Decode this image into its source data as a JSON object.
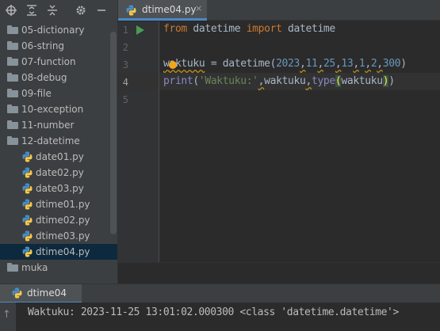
{
  "project": {
    "tree": [
      {
        "label": "05-dictionary",
        "kind": "folder"
      },
      {
        "label": "06-string",
        "kind": "folder"
      },
      {
        "label": "07-function",
        "kind": "folder"
      },
      {
        "label": "08-debug",
        "kind": "folder"
      },
      {
        "label": "09-file",
        "kind": "folder"
      },
      {
        "label": "10-exception",
        "kind": "folder"
      },
      {
        "label": "11-number",
        "kind": "folder"
      },
      {
        "label": "12-datetime",
        "kind": "folder"
      },
      {
        "label": "date01.py",
        "kind": "python-file"
      },
      {
        "label": "date02.py",
        "kind": "python-file"
      },
      {
        "label": "date03.py",
        "kind": "python-file"
      },
      {
        "label": "dtime01.py",
        "kind": "python-file"
      },
      {
        "label": "dtime02.py",
        "kind": "python-file"
      },
      {
        "label": "dtime03.py",
        "kind": "python-file"
      },
      {
        "label": "dtime04.py",
        "kind": "python-file",
        "selected": true
      },
      {
        "label": "muka",
        "kind": "folder"
      }
    ]
  },
  "editor": {
    "tab_label": "dtime04.py",
    "tab_close": "×",
    "line_numbers": [
      "1",
      "2",
      "3",
      "4",
      "5"
    ],
    "current_line": "4",
    "line1": {
      "kw1": "from",
      "mod": " datetime ",
      "kw2": "import",
      "name": " datetime"
    },
    "line3": {
      "var": "waktuku",
      "assign": " = datetime(",
      "n1": "2023",
      "c1": ",",
      "n2": "11",
      "c2": ",",
      "n3": "25",
      "c3": ",",
      "n4": "13",
      "c4": ",",
      "n5": "1",
      "c5": ",",
      "n6": "2",
      "c6": ",",
      "n7": "300",
      "close": ")"
    },
    "line4": {
      "fn": "print",
      "open": "(",
      "str": "'Waktuku:'",
      "c1": ",",
      "var": "waktuku",
      "c2": ",",
      "type": "type",
      "popen": "(",
      "arg": "waktuku",
      "pclose": ")",
      "close": ")"
    }
  },
  "run": {
    "tab_label": "dtime04",
    "output": "Waktuku: 2023-11-25 13:01:02.000300 <class 'datetime.datetime'>",
    "scroll_up_arrow": "↑"
  },
  "colors": {
    "accent": "#4a88c7",
    "keyword": "#cc7832",
    "number": "#6897bb",
    "string": "#6a8759",
    "builtin": "#8888c6",
    "selection": "#0d293e"
  }
}
